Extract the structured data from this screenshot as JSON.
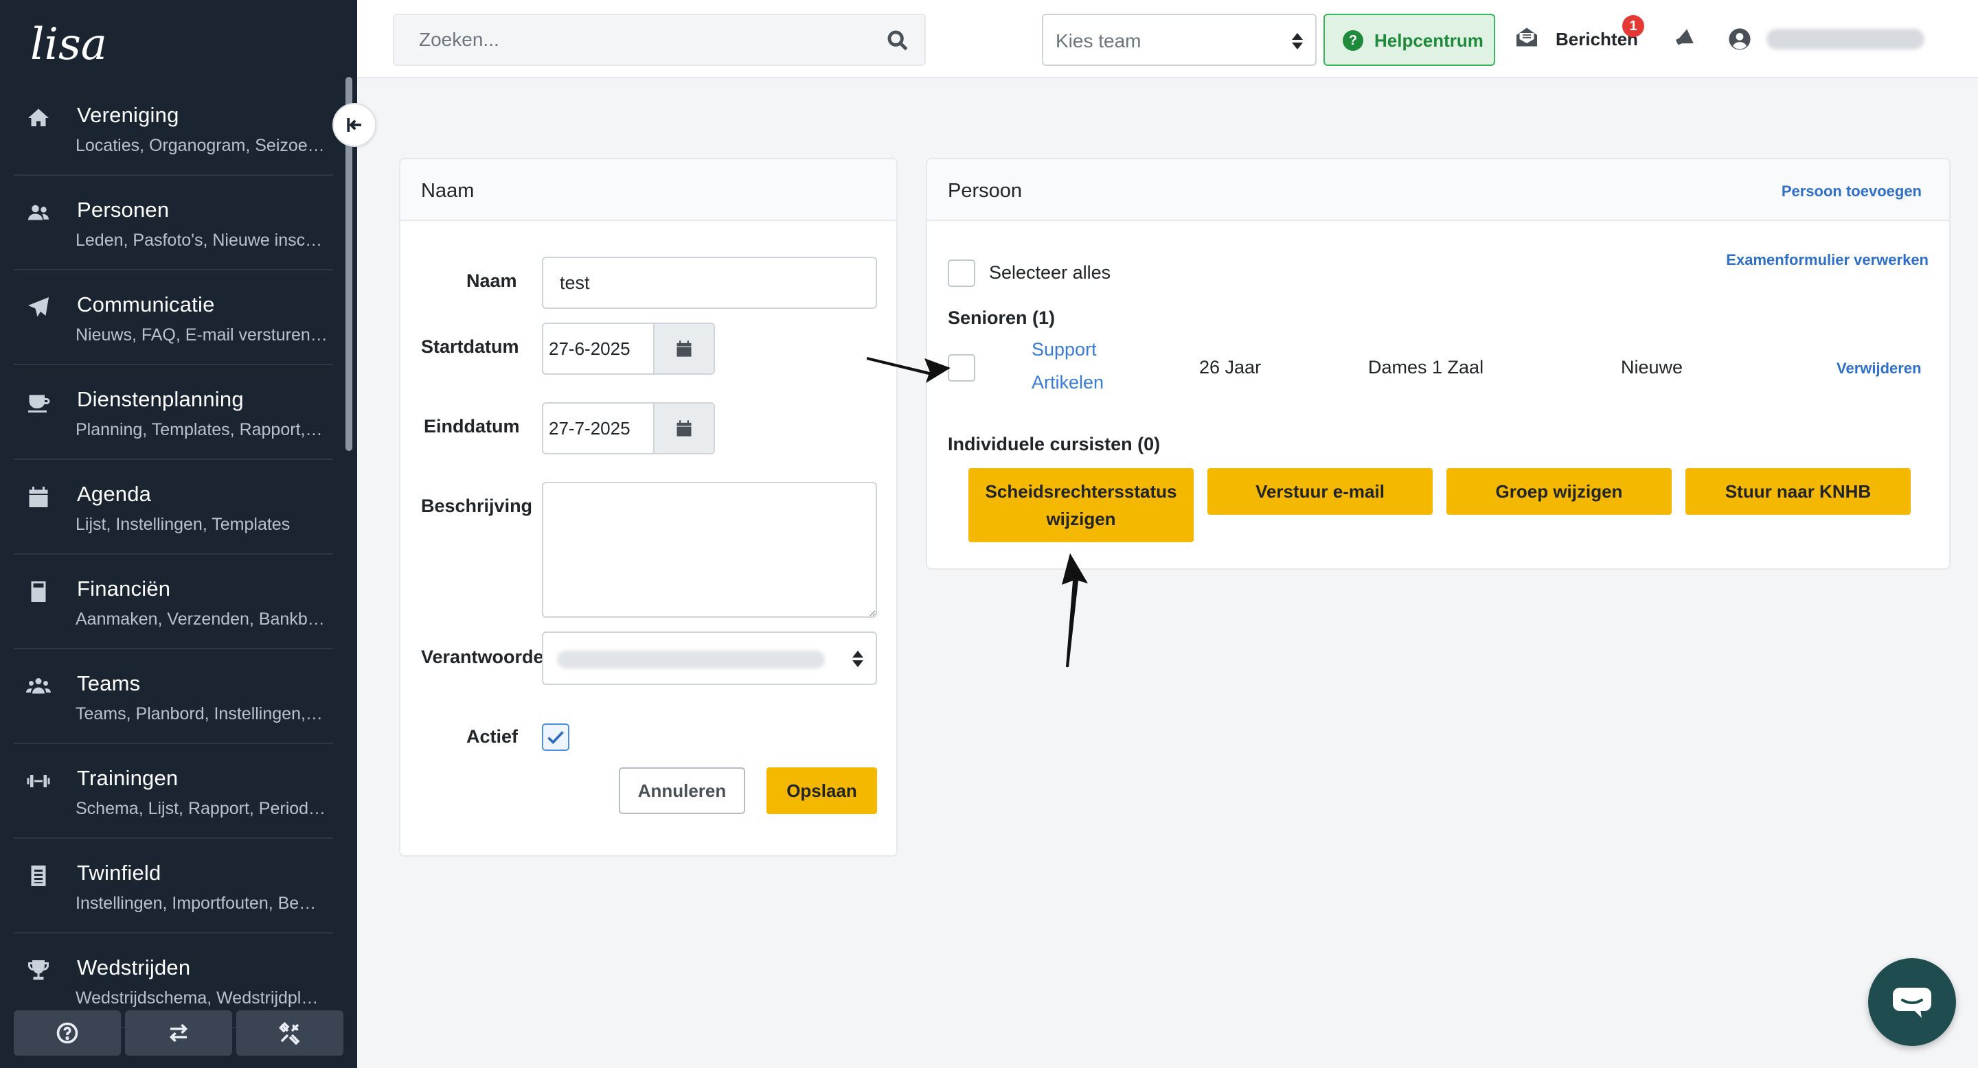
{
  "sidebar": {
    "logo": "lisa",
    "items": [
      {
        "title": "Vereniging",
        "sub": "Locaties, Organogram, Seizoe…",
        "icon": "home-icon"
      },
      {
        "title": "Personen",
        "sub": "Leden, Pasfoto's, Nieuwe insc…",
        "icon": "users-icon"
      },
      {
        "title": "Communicatie",
        "sub": "Nieuws, FAQ, E-mail versturen…",
        "icon": "paper-plane-icon"
      },
      {
        "title": "Dienstenplanning",
        "sub": "Planning, Templates, Rapport,…",
        "icon": "coffee-cup-icon"
      },
      {
        "title": "Agenda",
        "sub": "Lijst, Instellingen, Templates",
        "icon": "calendar-icon"
      },
      {
        "title": "Financiën",
        "sub": "Aanmaken, Verzenden, Bankb…",
        "icon": "calculator-icon"
      },
      {
        "title": "Teams",
        "sub": "Teams, Planbord, Instellingen,…",
        "icon": "team-icon"
      },
      {
        "title": "Trainingen",
        "sub": "Schema, Lijst, Rapport, Period…",
        "icon": "dumbbell-icon"
      },
      {
        "title": "Twinfield",
        "sub": "Instellingen, Importfouten, Be…",
        "icon": "document-icon"
      },
      {
        "title": "Wedstrijden",
        "sub": "Wedstrijdschema, Wedstrijdpl…",
        "icon": "trophy-icon"
      }
    ]
  },
  "topbar": {
    "search_placeholder": "Zoeken...",
    "team_select": "Kies team",
    "help_label": "Helpcentrum",
    "messages_label": "Berichten",
    "messages_badge": "1"
  },
  "naam_card": {
    "title": "Naam",
    "naam_label": "Naam",
    "naam_value": "test",
    "start_label": "Startdatum",
    "start_value": "27-6-2025",
    "end_label": "Einddatum",
    "end_value": "27-7-2025",
    "desc_label": "Beschrijving",
    "resp_label": "Verantwoordel",
    "active_label": "Actief",
    "cancel_label": "Annuleren",
    "save_label": "Opslaan"
  },
  "persoon_card": {
    "title": "Persoon",
    "add_person": "Persoon toevoegen",
    "select_all": "Selecteer alles",
    "exam_link": "Examenformulier verwerken",
    "group_seniors": "Senioren (1)",
    "person": {
      "name_line1": "Support",
      "name_line2": "Artikelen",
      "age": "26 Jaar",
      "team": "Dames 1 Zaal",
      "status": "Nieuwe",
      "remove": "Verwijderen"
    },
    "group_individual": "Individuele cursisten (0)",
    "actions": [
      "Scheidsrechtersstatus wijzigen",
      "Verstuur e-mail",
      "Groep wijzigen",
      "Stuur naar KNHB"
    ]
  },
  "colors": {
    "sidebar_bg": "#1b2532",
    "accent_yellow": "#f5b800",
    "link_blue": "#2f6fc7",
    "help_green": "#1f8a3b",
    "chat_bg": "#1f4d4f"
  }
}
